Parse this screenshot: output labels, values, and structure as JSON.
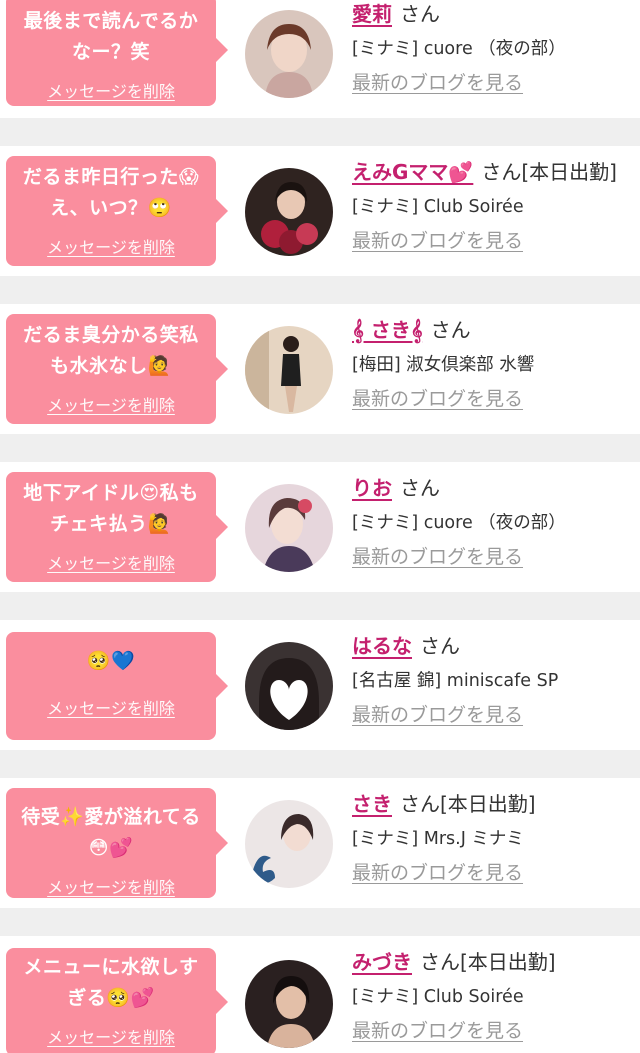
{
  "entries": [
    {
      "message": "最後まで読んでるかなー？笑",
      "delete_label": "メッセージを削除",
      "girl_name": "愛莉",
      "honorific": "さん",
      "status": "",
      "store": "[ミナミ] cuore （夜の部）",
      "blog_link": "最新のブログを見る",
      "avatar_colors": [
        "#e8c9bf",
        "#6b3a2a"
      ]
    },
    {
      "message": "だるま昨日行った😱え、いつ？🙄",
      "delete_label": "メッセージを削除",
      "girl_name": "えみGママ💕",
      "honorific": "さん",
      "status": "[本日出勤]",
      "store": "[ミナミ] Club Soirée",
      "blog_link": "最新のブログを見る",
      "avatar_colors": [
        "#3b2a24",
        "#b0203c"
      ]
    },
    {
      "message": "だるま臭分かる笑私も水氷なし🙋",
      "delete_label": "メッセージを削除",
      "girl_name": "𝄞 さき𝄞",
      "honorific": "さん",
      "status": "",
      "store": "[梅田] 淑女倶楽部 水響",
      "blog_link": "最新のブログを見る",
      "avatar_colors": [
        "#e8d6c3",
        "#1f1f1f"
      ]
    },
    {
      "message": "地下アイドル😍私もチェキ払う🙋",
      "delete_label": "メッセージを削除",
      "girl_name": "りお",
      "honorific": "さん",
      "status": "",
      "store": "[ミナミ] cuore （夜の部）",
      "blog_link": "最新のブログを見る",
      "avatar_colors": [
        "#e3cfd6",
        "#5a3b3b"
      ]
    },
    {
      "message": "🥺💙",
      "delete_label": "メッセージを削除",
      "girl_name": "はるな",
      "honorific": "さん",
      "status": "",
      "store": "[名古屋 錦] miniscafe SP",
      "blog_link": "最新のブログを見る",
      "avatar_colors": [
        "#3a3232",
        "#ffffff"
      ]
    },
    {
      "message": "待受✨愛が溢れてる😳💕",
      "delete_label": "メッセージを削除",
      "girl_name": "さき",
      "honorific": "さん",
      "status": "[本日出勤]",
      "store": "[ミナミ] Mrs.J ミナミ",
      "blog_link": "最新のブログを見る",
      "avatar_colors": [
        "#ece6e6",
        "#2f5b8a"
      ]
    },
    {
      "message": "メニューに水欲しすぎる🥺💕",
      "delete_label": "メッセージを削除",
      "girl_name": "みづき",
      "honorific": "さん",
      "status": "[本日出勤]",
      "store": "[ミナミ] Club Soirée",
      "blog_link": "最新のブログを見る",
      "avatar_colors": [
        "#2a2020",
        "#d9b39c"
      ]
    }
  ]
}
